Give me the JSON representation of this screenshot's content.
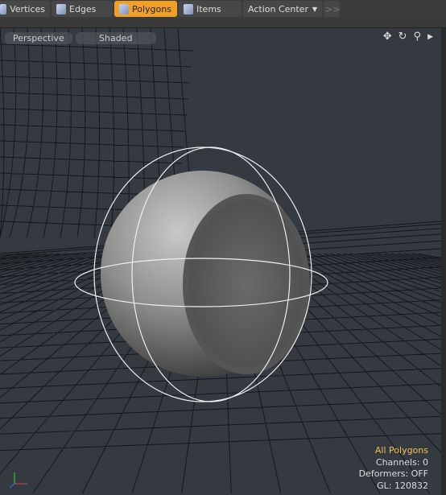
{
  "toolbar": {
    "items": [
      {
        "label": "Vertices",
        "active": false
      },
      {
        "label": "Edges",
        "active": false
      },
      {
        "label": "Polygons",
        "active": true
      },
      {
        "label": "Items",
        "active": false
      }
    ],
    "action_center": "Action Center",
    "more": ">>"
  },
  "viewport": {
    "view": "Perspective",
    "shading": "Shaded",
    "icons": [
      "move-icon",
      "rotate-icon",
      "zoom-icon",
      "play-icon"
    ]
  },
  "info": {
    "selection": "All Polygons",
    "channels": "Channels: 0",
    "deformers": "Deformers: OFF",
    "gl": "GL: 120832"
  },
  "colors": {
    "active": "#f0a024",
    "selection_text": "#f0c050",
    "viewport_bg": "#343a40"
  }
}
